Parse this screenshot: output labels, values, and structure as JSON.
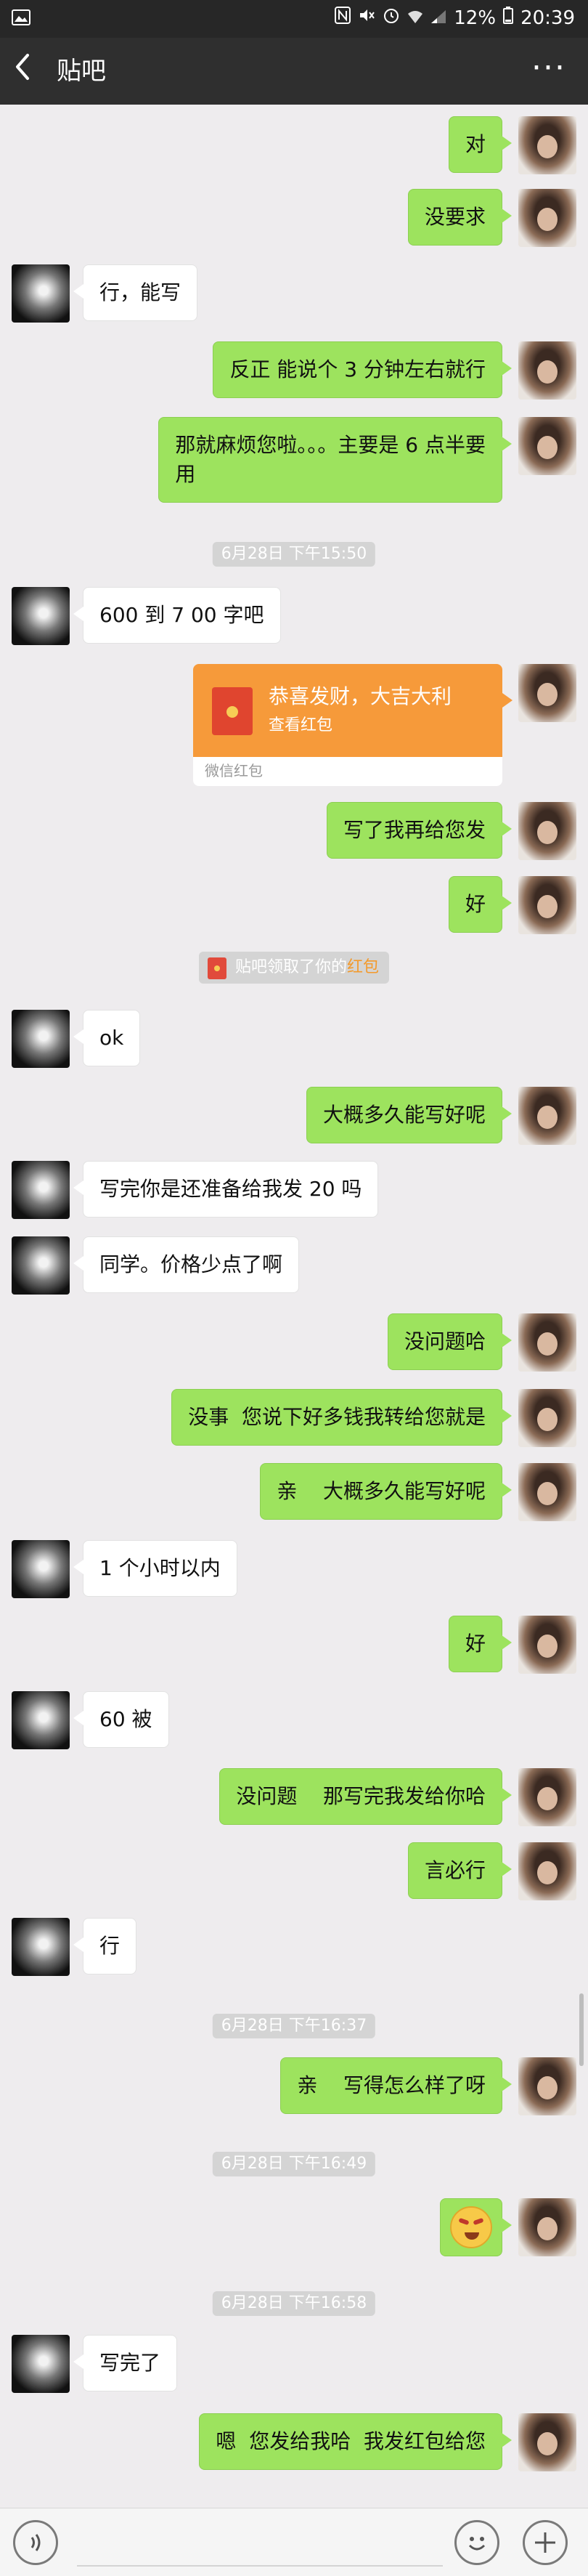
{
  "status_bar": {
    "battery": "12%",
    "time": "20:39",
    "icons": [
      "image-icon",
      "nfc-icon",
      "mute-icon",
      "alarm-icon",
      "wifi-icon",
      "signal-icon",
      "battery-icon"
    ]
  },
  "nav": {
    "back_icon": "chevron-left-icon",
    "title": "贴吧",
    "more_icon": "more-icon",
    "more_glyph": "···"
  },
  "chat": {
    "messages": [
      {
        "type": "self",
        "text": "对"
      },
      {
        "type": "self",
        "text": "没要求"
      },
      {
        "type": "other",
        "text": "行，能写"
      },
      {
        "type": "self",
        "text": "反正 能说个 3 分钟左右就行"
      },
      {
        "type": "self",
        "text": "那就麻烦您啦。。。主要是 6 点半要\n用"
      },
      {
        "type": "time",
        "text": "6月28日 下午15:50"
      },
      {
        "type": "other",
        "text": "600 到 7 00 字吧"
      },
      {
        "type": "redpacket",
        "title": "恭喜发财，大吉大利",
        "sub": "查看红包",
        "footer": "微信红包"
      },
      {
        "type": "self",
        "text": "写了我再给您发"
      },
      {
        "type": "self",
        "text": "好"
      },
      {
        "type": "notice",
        "text_before": "贴吧领取了你的",
        "highlight": "红包"
      },
      {
        "type": "other",
        "text": "ok"
      },
      {
        "type": "self",
        "text": "大概多久能写好呢"
      },
      {
        "type": "other",
        "text": "写完你是还准备给我发 20 吗"
      },
      {
        "type": "other",
        "text": "同学。价格少点了啊"
      },
      {
        "type": "self",
        "text": "没问题哈"
      },
      {
        "type": "self",
        "text": "没事  您说下好多钱我转给您就是"
      },
      {
        "type": "self",
        "text": "亲    大概多久能写好呢"
      },
      {
        "type": "other",
        "text": "1 个小时以内"
      },
      {
        "type": "self",
        "text": "好"
      },
      {
        "type": "other",
        "text": "60 被"
      },
      {
        "type": "self",
        "text": "没问题    那写完我发给你哈"
      },
      {
        "type": "self",
        "text": "言必行"
      },
      {
        "type": "other",
        "text": "行"
      },
      {
        "type": "time",
        "text": "6月28日 下午16:37"
      },
      {
        "type": "self",
        "text": "亲    写得怎么样了呀"
      },
      {
        "type": "time",
        "text": "6月28日 下午16:49"
      },
      {
        "type": "emoji",
        "emoji": "angry-face-emoji"
      },
      {
        "type": "time",
        "text": "6月28日 下午16:58"
      },
      {
        "type": "other",
        "text": "写完了"
      },
      {
        "type": "self",
        "text": "嗯  您发给我哈  我发红包给您"
      }
    ]
  },
  "input_bar": {
    "voice_icon": "voice-icon",
    "emoji_icon": "emoji-icon",
    "add_icon": "plus-icon"
  }
}
